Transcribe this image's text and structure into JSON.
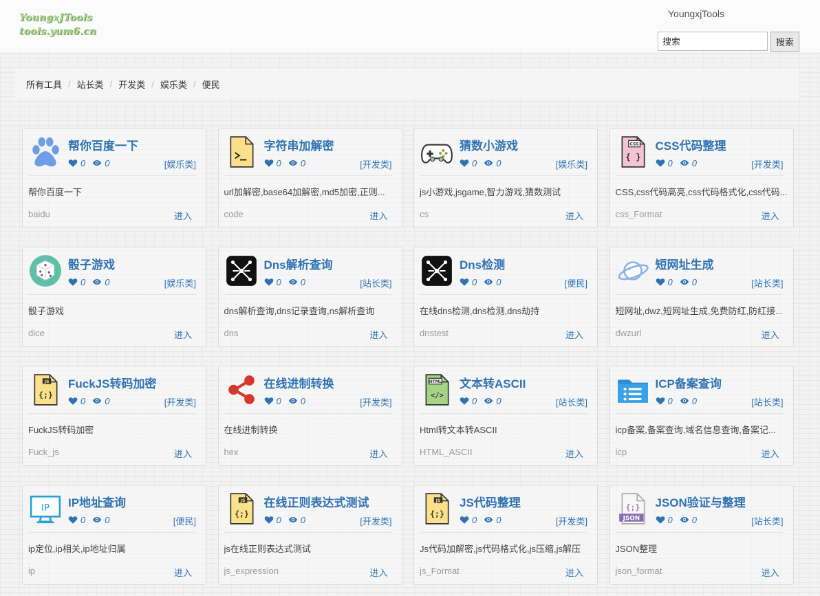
{
  "header": {
    "logo_line1": "YoungxJTools",
    "logo_line2": "tools.yum6.cn",
    "site_name": "YoungxjTools",
    "search": {
      "placeholder": "搜索",
      "button_label": "搜索"
    }
  },
  "breadcrumb": [
    "所有工具",
    "站长类",
    "开发类",
    "娱乐类",
    "便民"
  ],
  "colors": {
    "link": "#2f73b3",
    "logo": "#a8cf8e",
    "breadcrumb_bg": "#f5f5f5"
  },
  "cards": [
    {
      "icon": "baidu-paw",
      "title": "帮你百度一下",
      "likes": "0",
      "views": "0",
      "category": "[娱乐类]",
      "description": "帮你百度一下",
      "slug": "baidu",
      "enter_label": "进入"
    },
    {
      "icon": "terminal-file",
      "title": "字符串加解密",
      "likes": "0",
      "views": "0",
      "category": "[开发类]",
      "description": "url加解密,base64加解密,md5加密,正则...",
      "slug": "code",
      "enter_label": "进入"
    },
    {
      "icon": "gamepad",
      "title": "猜数小游戏",
      "likes": "0",
      "views": "0",
      "category": "[娱乐类]",
      "description": "js小游戏,jsgame,智力游戏,猜数测试",
      "slug": "cs",
      "enter_label": "进入"
    },
    {
      "icon": "css-file",
      "title": "CSS代码整理",
      "likes": "0",
      "views": "0",
      "category": "[开发类]",
      "description": "CSS,css代码高亮,css代码格式化,css代码...",
      "slug": "css_Format",
      "enter_label": "进入"
    },
    {
      "icon": "dice",
      "title": "骰子游戏",
      "likes": "0",
      "views": "0",
      "category": "[娱乐类]",
      "description": "骰子游戏",
      "slug": "dice",
      "enter_label": "进入"
    },
    {
      "icon": "network",
      "title": "Dns解析查询",
      "likes": "0",
      "views": "0",
      "category": "[站长类]",
      "description": "dns解析查询,dns记录查询,ns解析查询",
      "slug": "dns",
      "enter_label": "进入"
    },
    {
      "icon": "network",
      "title": "Dns检测",
      "likes": "0",
      "views": "0",
      "category": "[便民]",
      "description": "在线dns检测,dns检测,dns劫持",
      "slug": "dnstest",
      "enter_label": "进入"
    },
    {
      "icon": "planet",
      "title": "短网址生成",
      "likes": "0",
      "views": "0",
      "category": "[站长类]",
      "description": "短网址,dwz,短网址生成,免费防红,防红接...",
      "slug": "dwzurl",
      "enter_label": "进入"
    },
    {
      "icon": "js-file",
      "title": "FuckJS转码加密",
      "likes": "0",
      "views": "0",
      "category": "[开发类]",
      "description": "FuckJS转码加密",
      "slug": "Fuck_js",
      "enter_label": "进入"
    },
    {
      "icon": "share-nodes",
      "title": "在线进制转换",
      "likes": "0",
      "views": "0",
      "category": "[开发类]",
      "description": "在线进制转换",
      "slug": "hex",
      "enter_label": "进入"
    },
    {
      "icon": "html-file",
      "title": "文本转ASCII",
      "likes": "0",
      "views": "0",
      "category": "[站长类]",
      "description": "Html转文本转ASCII",
      "slug": "HTML_ASCII",
      "enter_label": "进入"
    },
    {
      "icon": "list-folder",
      "title": "ICP备案查询",
      "likes": "0",
      "views": "0",
      "category": "[站长类]",
      "description": "icp备案,备案查询,域名信息查询,备案记...",
      "slug": "icp",
      "enter_label": "进入"
    },
    {
      "icon": "ip-monitor",
      "title": "IP地址查询",
      "likes": "0",
      "views": "0",
      "category": "[便民]",
      "description": "ip定位,ip相关,ip地址归属",
      "slug": "ip",
      "enter_label": "进入"
    },
    {
      "icon": "js-file",
      "title": "在线正则表达式测试",
      "likes": "0",
      "views": "0",
      "category": "[开发类]",
      "description": "js在线正则表达式测试",
      "slug": "js_expression",
      "enter_label": "进入"
    },
    {
      "icon": "js-file",
      "title": "JS代码整理",
      "likes": "0",
      "views": "0",
      "category": "[开发类]",
      "description": "Js代码加解密,js代码格式化,js压缩,js解压",
      "slug": "js_Format",
      "enter_label": "进入"
    },
    {
      "icon": "json-file",
      "title": "JSON验证与整理",
      "likes": "0",
      "views": "0",
      "category": "[站长类]",
      "description": "JSON整理",
      "slug": "json_format",
      "enter_label": "进入"
    }
  ]
}
